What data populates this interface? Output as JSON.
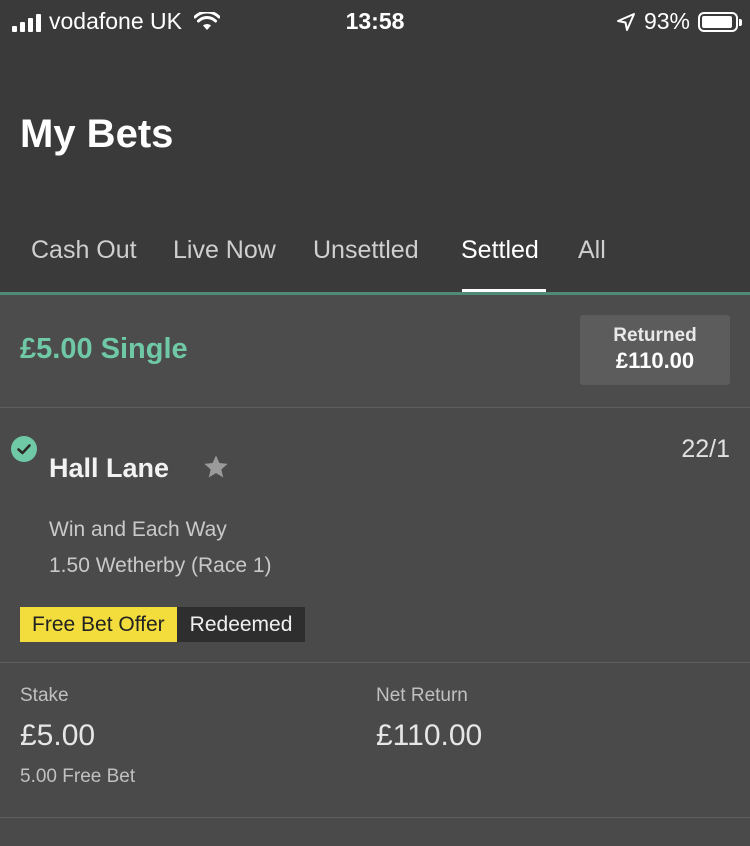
{
  "status_bar": {
    "carrier": "vodafone UK",
    "time": "13:58",
    "battery": "93%"
  },
  "header": {
    "title": "My Bets",
    "tabs": [
      {
        "label": "Cash Out",
        "active": false
      },
      {
        "label": "Live Now",
        "active": false
      },
      {
        "label": "Unsettled",
        "active": false
      },
      {
        "label": "Settled",
        "active": true
      },
      {
        "label": "All",
        "active": false
      }
    ]
  },
  "bet": {
    "title": "£5.00 Single",
    "returned_label": "Returned",
    "returned_amount": "£110.00",
    "selection": {
      "name": "Hall Lane",
      "odds": "22/1",
      "market": "Win and Each Way",
      "race": "1.50 Wetherby (Race 1)",
      "offer_badge": "Free Bet Offer",
      "offer_status": "Redeemed"
    },
    "stake_label": "Stake",
    "stake_value": "£5.00",
    "stake_note": "5.00 Free Bet",
    "net_return_label": "Net Return",
    "net_return_value": "£110.00"
  },
  "colors": {
    "header_bg": "#3a3a3a",
    "accent_green": "#6fc8a6",
    "badge_yellow": "#f3dd3c"
  }
}
